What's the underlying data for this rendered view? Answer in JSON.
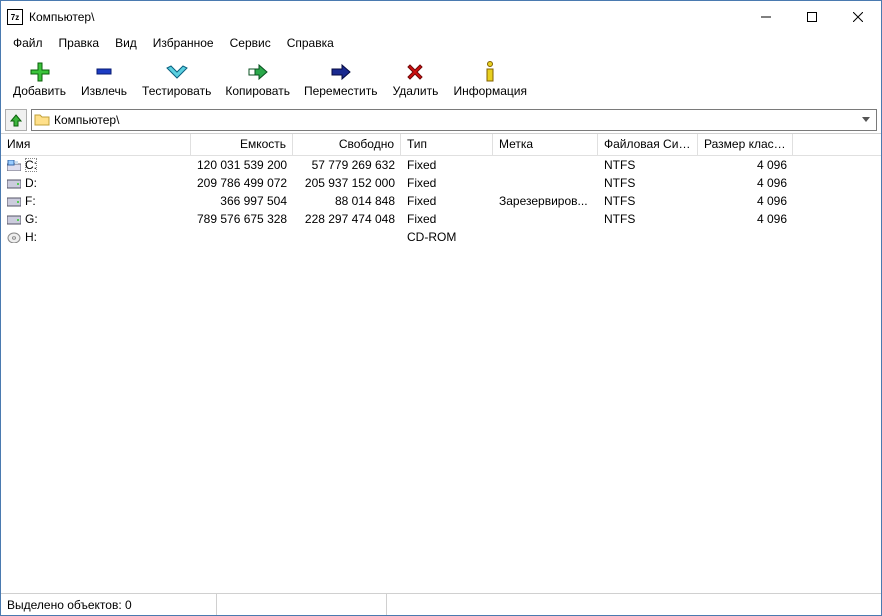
{
  "window": {
    "app_badge": "7z",
    "title": "Компьютер\\"
  },
  "menu": [
    "Файл",
    "Правка",
    "Вид",
    "Избранное",
    "Сервис",
    "Справка"
  ],
  "toolbar": {
    "add": "Добавить",
    "extract": "Извлечь",
    "test": "Тестировать",
    "copy": "Копировать",
    "move": "Переместить",
    "delete": "Удалить",
    "info": "Информация"
  },
  "path": {
    "value": "Компьютер\\"
  },
  "columns": {
    "name": "Имя",
    "capacity": "Емкость",
    "free": "Свободно",
    "type": "Тип",
    "label": "Метка",
    "fs": "Файловая Сис...",
    "cluster": "Размер класте..."
  },
  "drives": [
    {
      "name": "C:",
      "icon": "system",
      "cap": "120 031 539 200",
      "free": "57 779 269 632",
      "type": "Fixed",
      "label": "",
      "fs": "NTFS",
      "cluster": "4 096"
    },
    {
      "name": "D:",
      "icon": "hdd",
      "cap": "209 786 499 072",
      "free": "205 937 152 000",
      "type": "Fixed",
      "label": "",
      "fs": "NTFS",
      "cluster": "4 096"
    },
    {
      "name": "F:",
      "icon": "hdd",
      "cap": "366 997 504",
      "free": "88 014 848",
      "type": "Fixed",
      "label": "Зарезервиров...",
      "fs": "NTFS",
      "cluster": "4 096"
    },
    {
      "name": "G:",
      "icon": "hdd",
      "cap": "789 576 675 328",
      "free": "228 297 474 048",
      "type": "Fixed",
      "label": "",
      "fs": "NTFS",
      "cluster": "4 096"
    },
    {
      "name": "H:",
      "icon": "cd",
      "cap": "",
      "free": "",
      "type": "CD-ROM",
      "label": "",
      "fs": "",
      "cluster": ""
    }
  ],
  "status": {
    "selected": "Выделено объектов: 0"
  }
}
